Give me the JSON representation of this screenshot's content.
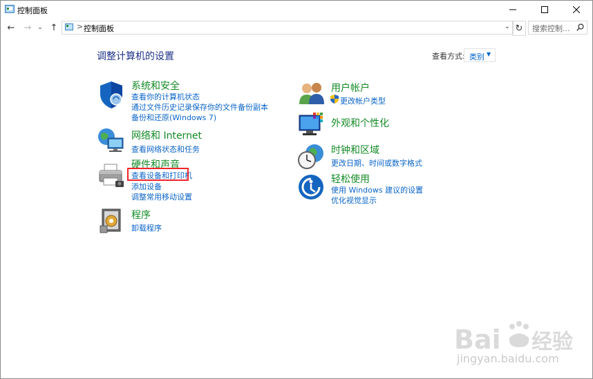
{
  "window": {
    "title": "控制面板",
    "controls": {
      "minimize": "minimize-icon",
      "maximize": "maximize-icon",
      "close": "close-icon"
    }
  },
  "nav": {
    "back": "←",
    "forward": "→",
    "recent": "⌄",
    "up": "↑",
    "address": {
      "segment": "控制面板",
      "separator": ">"
    },
    "refresh": "↻",
    "search": {
      "placeholder": "搜索控制..."
    }
  },
  "content": {
    "heading": "调整计算机的设置",
    "view_by": {
      "label": "查看方式:",
      "value": "类别",
      "arrow": "▼"
    },
    "left": [
      {
        "title": "系统和安全",
        "icon": "shield-icon",
        "links": [
          "查看你的计算机状态",
          "通过文件历史记录保存你的文件备份副本",
          "备份和还原(Windows 7)"
        ]
      },
      {
        "title": "网络和 Internet",
        "icon": "globe-network-icon",
        "links": [
          "查看网络状态和任务"
        ]
      },
      {
        "title": "硬件和声音",
        "icon": "printer-icon",
        "links": [
          "查看设备和打印机",
          "添加设备",
          "调整常用移动设置"
        ]
      },
      {
        "title": "程序",
        "icon": "programs-icon",
        "links": [
          "卸载程序"
        ]
      }
    ],
    "right": [
      {
        "title": "用户帐户",
        "icon": "users-icon",
        "links": [
          "更改帐户类型"
        ]
      },
      {
        "title": "外观和个性化",
        "icon": "appearance-icon",
        "links": []
      },
      {
        "title": "时钟和区域",
        "icon": "clock-globe-icon",
        "links": [
          "更改日期、时间或数字格式"
        ]
      },
      {
        "title": "轻松使用",
        "icon": "ease-of-access-icon",
        "links": [
          "使用 Windows 建议的设置",
          "优化视觉显示"
        ]
      }
    ]
  },
  "watermark": {
    "brand": "Baidu经验",
    "url": "jingyan.baidu.com"
  },
  "colors": {
    "heading": "#1e3287",
    "category": "#138a25",
    "link": "#0a64c8",
    "highlight": "#f0262a"
  }
}
